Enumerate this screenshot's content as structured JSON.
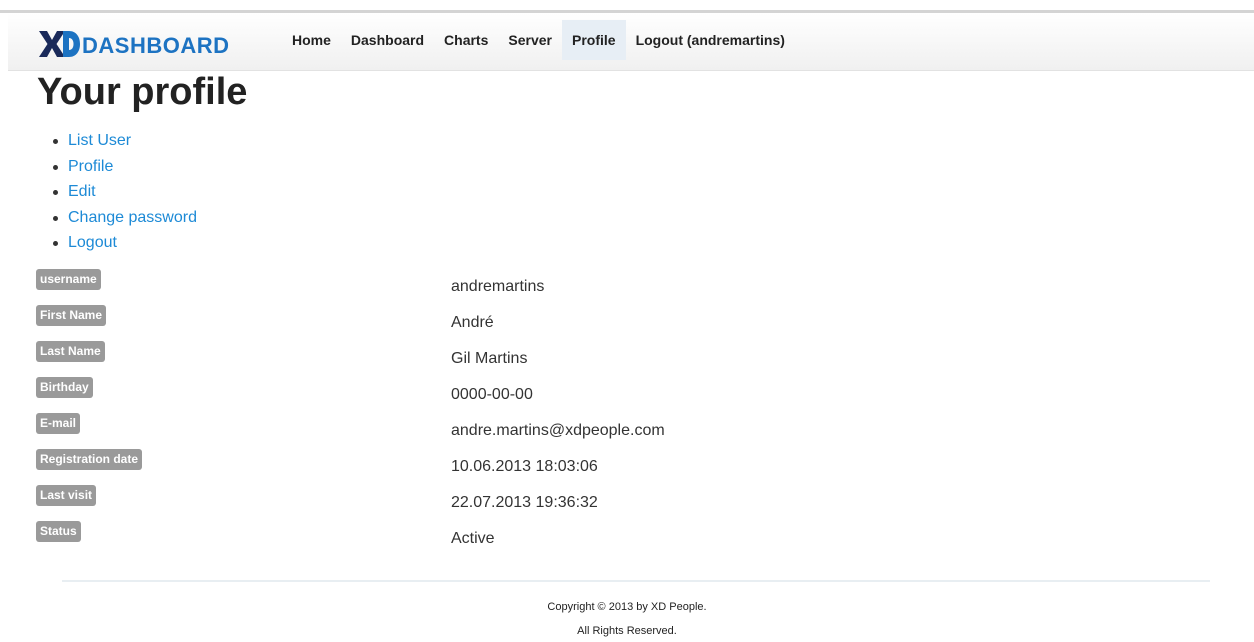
{
  "brand": {
    "mark": "XD",
    "text": "DASHBOARD"
  },
  "nav": {
    "items": [
      {
        "label": "Home"
      },
      {
        "label": "Dashboard"
      },
      {
        "label": "Charts"
      },
      {
        "label": "Server"
      },
      {
        "label": "Profile",
        "active": true
      },
      {
        "label": "Logout (andremartins)"
      }
    ]
  },
  "page": {
    "title": "Your profile"
  },
  "subnav": {
    "items": [
      {
        "label": "List User"
      },
      {
        "label": "Profile"
      },
      {
        "label": "Edit"
      },
      {
        "label": "Change password"
      },
      {
        "label": "Logout"
      }
    ]
  },
  "profile": {
    "rows": [
      {
        "label": "username",
        "value": "andremartins"
      },
      {
        "label": "First Name",
        "value": "André"
      },
      {
        "label": "Last Name",
        "value": "Gil Martins"
      },
      {
        "label": "Birthday",
        "value": "0000-00-00"
      },
      {
        "label": "E-mail",
        "value": "andre.martins@xdpeople.com"
      },
      {
        "label": "Registration date",
        "value": "10.06.2013 18:03:06"
      },
      {
        "label": "Last visit",
        "value": "22.07.2013 19:36:32"
      },
      {
        "label": "Status",
        "value": "Active"
      }
    ]
  },
  "footer": {
    "copyright": "Copyright © 2013 by XD People.",
    "rights": "All Rights Reserved."
  },
  "colors": {
    "brand_blue": "#1d73c2",
    "brand_navy": "#1a2a5a",
    "link": "#1d8ad6",
    "label_bg": "#9a9a9a",
    "active_nav_bg": "#e7eef5"
  }
}
